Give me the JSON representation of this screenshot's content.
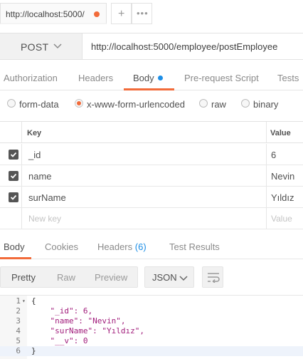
{
  "tab": {
    "url": "http://localhost:5000/",
    "unsaved_dot_color": "#f26b3a"
  },
  "tab_actions": {
    "new_tab_icon": "plus-icon",
    "more_icon": "ellipsis-icon"
  },
  "request": {
    "method": "POST",
    "url": "http://localhost:5000/employee/postEmployee"
  },
  "request_tabs": [
    {
      "label": "Authorization",
      "active": false
    },
    {
      "label": "Headers",
      "active": false
    },
    {
      "label": "Body",
      "active": true
    },
    {
      "label": "Pre-request Script",
      "active": false
    },
    {
      "label": "Tests",
      "active": false
    }
  ],
  "body_types": [
    {
      "label": "form-data",
      "selected": false
    },
    {
      "label": "x-www-form-urlencoded",
      "selected": true
    },
    {
      "label": "raw",
      "selected": false
    },
    {
      "label": "binary",
      "selected": false
    }
  ],
  "params_table": {
    "key_header": "Key",
    "value_header": "Value",
    "rows": [
      {
        "key": "_id",
        "value": "6",
        "checked": true
      },
      {
        "key": "name",
        "value": "Nevin",
        "checked": true
      },
      {
        "key": "surName",
        "value": "Yıldız",
        "checked": true
      }
    ],
    "new_key_placeholder": "New key",
    "new_value_placeholder": "Value"
  },
  "response_tabs": [
    {
      "label": "Body",
      "active": true
    },
    {
      "label": "Cookies",
      "active": false
    },
    {
      "label": "Headers",
      "count": "(6)",
      "active": false
    },
    {
      "label": "Test Results",
      "active": false
    }
  ],
  "response_toolbar": {
    "views": [
      "Pretty",
      "Raw",
      "Preview"
    ],
    "active_view": "Pretty",
    "format": "JSON",
    "wrap_icon": "wrap-lines-icon"
  },
  "response_body": {
    "line_numbers": [
      "1",
      "2",
      "3",
      "4",
      "5",
      "6"
    ],
    "lines": [
      "{",
      "    \"_id\": 6,",
      "    \"name\": \"Nevin\",",
      "    \"surName\": \"Yıldız\",",
      "    \"__v\": 0",
      "}"
    ]
  },
  "colors": {
    "accent": "#f26b3a",
    "link_blue": "#1d8ee6"
  }
}
